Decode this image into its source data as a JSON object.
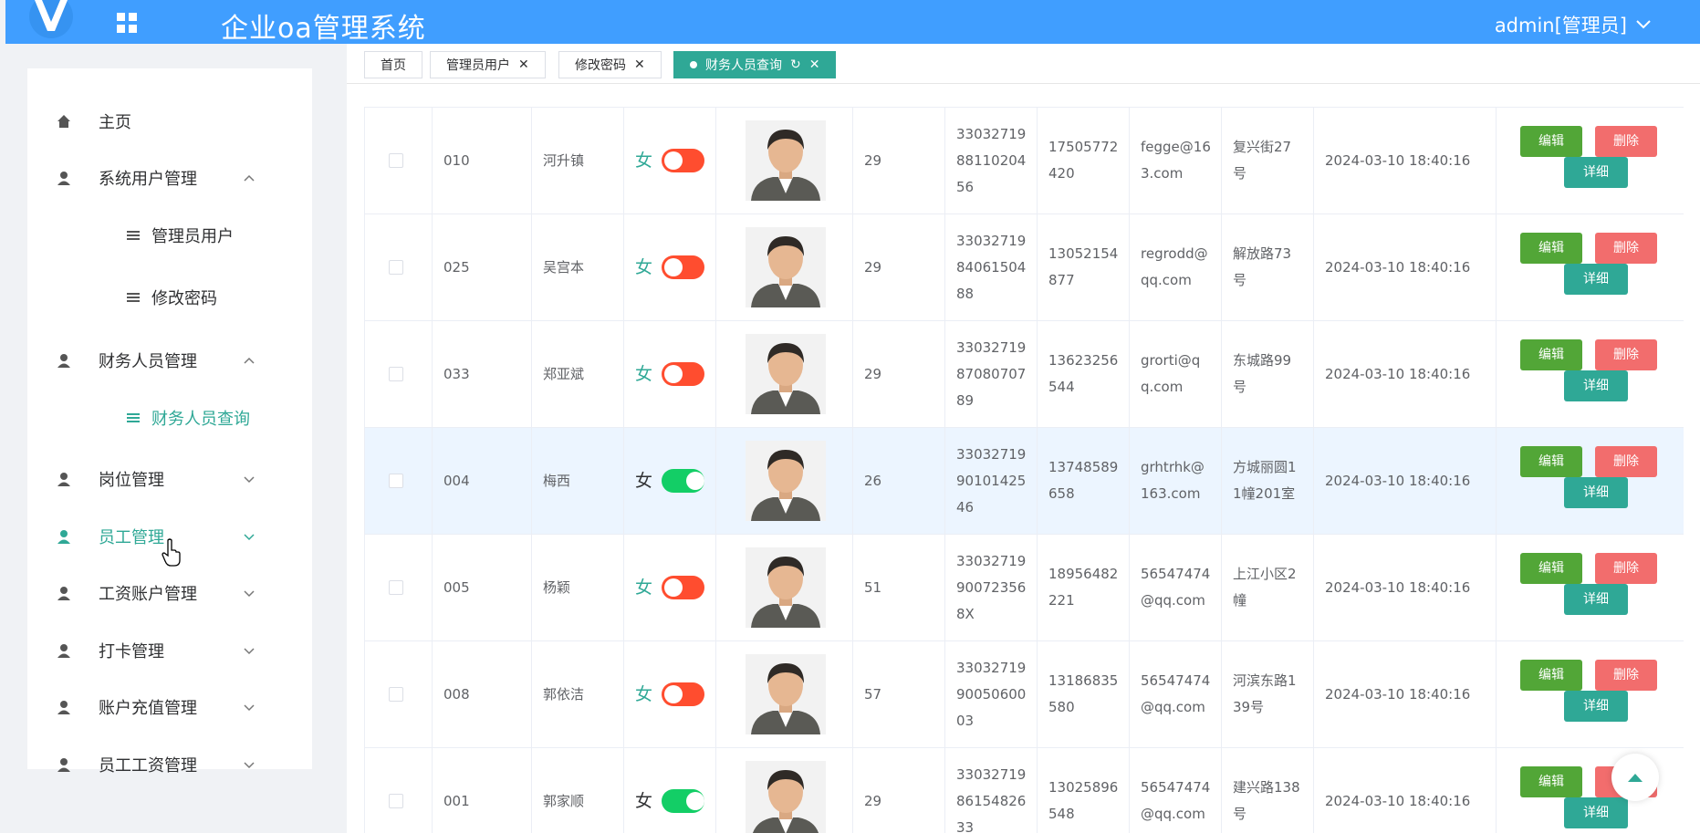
{
  "header": {
    "app_title": "企业oa管理系统",
    "user_label": "admin[管理员]"
  },
  "sidebar": {
    "items": [
      {
        "label": "主页"
      },
      {
        "label": "系统用户管理"
      },
      {
        "label": "管理员用户"
      },
      {
        "label": "修改密码"
      },
      {
        "label": "财务人员管理"
      },
      {
        "label": "财务人员查询"
      },
      {
        "label": "岗位管理"
      },
      {
        "label": "员工管理"
      },
      {
        "label": "工资账户管理"
      },
      {
        "label": "打卡管理"
      },
      {
        "label": "账户充值管理"
      },
      {
        "label": "员工工资管理"
      }
    ]
  },
  "tabs": [
    {
      "label": "首页"
    },
    {
      "label": "管理员用户"
    },
    {
      "label": "修改密码"
    },
    {
      "label": "财务人员查询"
    }
  ],
  "table": {
    "rows": [
      {
        "id": "010",
        "name": "河升镇",
        "gender": "女",
        "enabled": false,
        "age": "29",
        "idcard": [
          "33032719",
          "88110204",
          "56"
        ],
        "phone": [
          "17505772",
          "420"
        ],
        "email": [
          "fegge@16",
          "3.com"
        ],
        "address": [
          "复兴街27",
          "号"
        ],
        "time": "2024-03-10 18:40:16"
      },
      {
        "id": "025",
        "name": "吴宫本",
        "gender": "女",
        "enabled": false,
        "age": "29",
        "idcard": [
          "33032719",
          "84061504",
          "88"
        ],
        "phone": [
          "13052154",
          "877"
        ],
        "email": [
          "regrodd@",
          "qq.com"
        ],
        "address": [
          "解放路73",
          "号"
        ],
        "time": "2024-03-10 18:40:16"
      },
      {
        "id": "033",
        "name": "郑亚斌",
        "gender": "女",
        "enabled": false,
        "age": "29",
        "idcard": [
          "33032719",
          "87080707",
          "89"
        ],
        "phone": [
          "13623256",
          "544"
        ],
        "email": [
          "grorti@q",
          "q.com"
        ],
        "address": [
          "东城路99",
          "号"
        ],
        "time": "2024-03-10 18:40:16"
      },
      {
        "id": "004",
        "name": "梅西",
        "gender": "女",
        "enabled": true,
        "age": "26",
        "idcard": [
          "33032719",
          "90101425",
          "46"
        ],
        "phone": [
          "13748589",
          "658"
        ],
        "email": [
          "grhtrhk@",
          "163.com"
        ],
        "address": [
          "方城丽圆1",
          "1幢201室"
        ],
        "time": "2024-03-10 18:40:16"
      },
      {
        "id": "005",
        "name": "杨颖",
        "gender": "女",
        "enabled": false,
        "age": "51",
        "idcard": [
          "33032719",
          "90072356",
          "8X"
        ],
        "phone": [
          "18956482",
          "221"
        ],
        "email": [
          "56547474",
          "@qq.com"
        ],
        "address": [
          "上江小区2",
          "幢"
        ],
        "time": "2024-03-10 18:40:16"
      },
      {
        "id": "008",
        "name": "郭依洁",
        "gender": "女",
        "enabled": false,
        "age": "57",
        "idcard": [
          "33032719",
          "90050600",
          "03"
        ],
        "phone": [
          "13186835",
          "580"
        ],
        "email": [
          "56547474",
          "@qq.com"
        ],
        "address": [
          "河滨东路1",
          "39号"
        ],
        "time": "2024-03-10 18:40:16"
      },
      {
        "id": "001",
        "name": "郭家顺",
        "gender": "女",
        "enabled": true,
        "age": "29",
        "idcard": [
          "33032719",
          "86154826",
          "33"
        ],
        "phone": [
          "13025896",
          "548"
        ],
        "email": [
          "56547474",
          "@qq.com"
        ],
        "address": [
          "建兴路138",
          "号"
        ],
        "time": "2024-03-10 18:40:16"
      }
    ],
    "actions": {
      "edit": "编辑",
      "delete": "删除",
      "detail": "详细"
    }
  },
  "colors": {
    "header": "#409eff",
    "accent": "#2fa896",
    "switch_on": "#13ce66",
    "switch_off": "#ff4d2f",
    "edit": "#52a637",
    "delete": "#f26d6d"
  },
  "icons": [
    "home-icon",
    "user-icon",
    "list-icon",
    "chevron-up-icon",
    "chevron-down-icon",
    "grid-icon",
    "refresh-icon",
    "close-icon",
    "back-to-top-icon"
  ]
}
